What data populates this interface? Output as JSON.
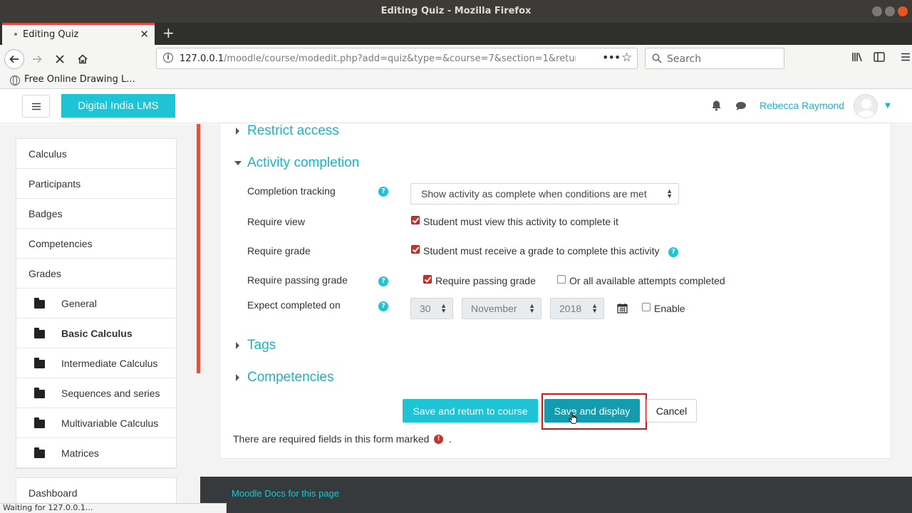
{
  "window": {
    "title": "Editing Quiz - Mozilla Firefox"
  },
  "browser": {
    "tab_title": "Editing Quiz",
    "url_host": "127.0.0.1",
    "url_path": "/moodle/course/modedit.php?add=quiz&type=&course=7&section=1&retur",
    "search_placeholder": "Search",
    "bookmark": "Free Online Drawing L...",
    "status_text": "Waiting for 127.0.0.1..."
  },
  "header": {
    "brand": "Digital India LMS",
    "user_name": "Rebecca Raymond"
  },
  "sidebar": {
    "items": [
      {
        "label": "Calculus"
      },
      {
        "label": "Participants"
      },
      {
        "label": "Badges"
      },
      {
        "label": "Competencies"
      },
      {
        "label": "Grades"
      },
      {
        "label": "General"
      },
      {
        "label": "Basic Calculus"
      },
      {
        "label": "Intermediate Calculus"
      },
      {
        "label": "Sequences and series"
      },
      {
        "label": "Multivariable Calculus"
      },
      {
        "label": "Matrices"
      }
    ],
    "dashboard": "Dashboard"
  },
  "form": {
    "sections": {
      "restrict_access": "Restrict access",
      "activity_completion": "Activity completion",
      "tags": "Tags",
      "competencies": "Competencies"
    },
    "completion_tracking": {
      "label": "Completion tracking",
      "value": "Show activity as complete when conditions are met"
    },
    "require_view": {
      "label": "Require view",
      "checkbox": "Student must view this activity to complete it",
      "checked": true
    },
    "require_grade": {
      "label": "Require grade",
      "checkbox": "Student must receive a grade to complete this activity",
      "checked": true
    },
    "require_passing_grade": {
      "label": "Require passing grade",
      "checkbox": "Require passing grade",
      "checked": true,
      "alt_checkbox": "Or all available attempts completed",
      "alt_checked": false
    },
    "expect_completed": {
      "label": "Expect completed on",
      "day": "30",
      "month": "November",
      "year": "2018",
      "enable_label": "Enable",
      "enabled": false
    },
    "buttons": {
      "save_return": "Save and return to course",
      "save_display": "Save and display",
      "cancel": "Cancel"
    },
    "required_note": "There are required fields in this form marked",
    "required_note_end": "."
  },
  "footer": {
    "docs_link": "Moodle Docs for this page"
  },
  "colors": {
    "accent": "#1fc3d6",
    "highlight_box": "#e20f0f",
    "footer_bg": "#373a3c",
    "checkbox": "#c9302c"
  }
}
